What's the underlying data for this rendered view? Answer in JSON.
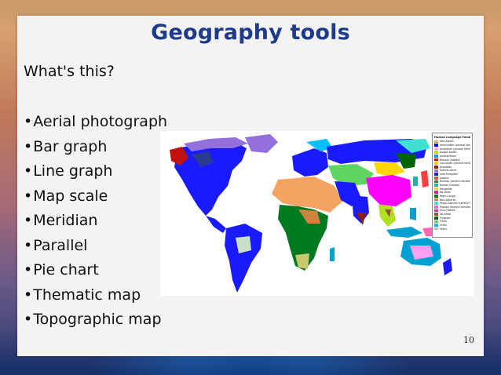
{
  "slide": {
    "title": "Geography tools",
    "question": "What's this?",
    "bullet_char": "•",
    "bullets": [
      "Aerial photograph",
      "Bar graph",
      "Line graph",
      "Map scale",
      "Meridian",
      "Parallel",
      "Pie chart",
      "Thematic map",
      "Topographic map"
    ],
    "page_number": "10"
  },
  "map": {
    "legend_title": "Human Language Families",
    "legend_items": [
      {
        "label": "Afro-Asiatic",
        "color": "#f4a460"
      },
      {
        "label": "Amerindian (several families)",
        "color": "#1010e0"
      },
      {
        "label": "Australian (several families)",
        "color": "#ff9ff0"
      },
      {
        "label": "Austro-Asiatic",
        "color": "#b0e020"
      },
      {
        "label": "Austronesian",
        "color": "#00a0d0"
      },
      {
        "label": "Basque (isolate)",
        "color": "#e00000"
      },
      {
        "label": "Caucasian (several families)",
        "color": "#ffd000"
      },
      {
        "label": "Dravidian",
        "color": "#8b2010"
      },
      {
        "label": "Eskimo–Aleut",
        "color": "#9370db"
      },
      {
        "label": "Indo-European",
        "color": "#1a1aff"
      },
      {
        "label": "Japonic",
        "color": "#ff4040"
      },
      {
        "label": "Khoisan (several families)",
        "color": "#556b2f"
      },
      {
        "label": "Korean (isolate)",
        "color": "#20b2aa"
      },
      {
        "label": "Mongolian",
        "color": "#ffd700"
      },
      {
        "label": "Na-Dene",
        "color": "#d02090"
      },
      {
        "label": "Niger-Congo",
        "color": "#007a20"
      },
      {
        "label": "Nilo-Saharan",
        "color": "#cd853f"
      },
      {
        "label": "Paleo-Siberian (several families)",
        "color": "#40e0d0"
      },
      {
        "label": "Papuan (several families)",
        "color": "#ff69b4"
      },
      {
        "label": "Sino-Tibetan",
        "color": "#ff00ff"
      },
      {
        "label": "Tai-Kadai",
        "color": "#a0522d"
      },
      {
        "label": "Tungusic",
        "color": "#006400"
      },
      {
        "label": "Turkic",
        "color": "#5fd45f"
      },
      {
        "label": "Uralic",
        "color": "#00c0ff"
      },
      {
        "label": "Other",
        "color": "#c0c0c0"
      }
    ]
  }
}
